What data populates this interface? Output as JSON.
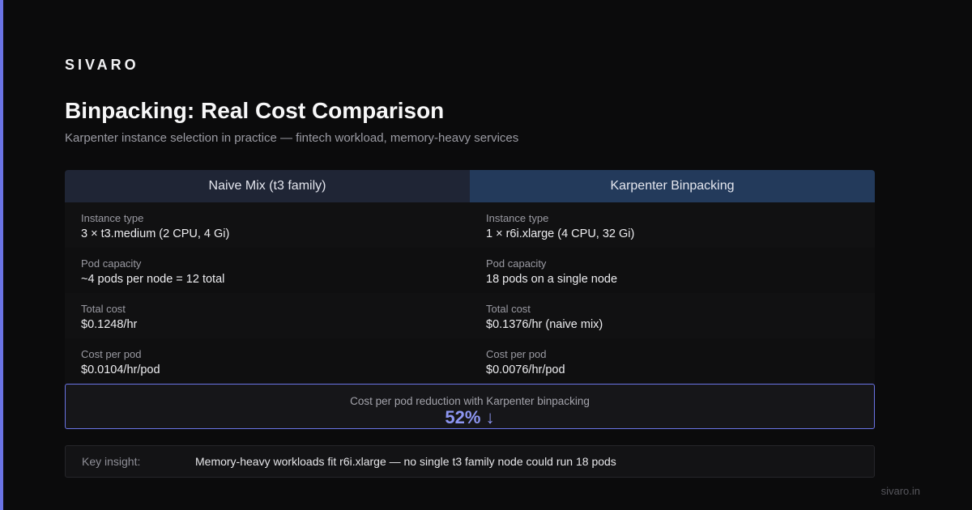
{
  "brand": {
    "logo": "SIVARO",
    "footer": "sivaro.in",
    "accent_color": "#6b74e6"
  },
  "header": {
    "title": "Binpacking: Real Cost Comparison",
    "subtitle": "Karpenter instance selection in practice — fintech workload, memory-heavy services"
  },
  "comparison": {
    "left": {
      "title": "Naive Mix (t3 family)",
      "rows": [
        {
          "label": "Instance type",
          "value": "3 × t3.medium (2 CPU, 4 Gi)"
        },
        {
          "label": "Pod capacity",
          "value": "~4 pods per node = 12 total"
        },
        {
          "label": "Total cost",
          "value": "$0.1248/hr"
        },
        {
          "label": "Cost per pod",
          "value": "$0.0104/hr/pod"
        }
      ]
    },
    "right": {
      "title": "Karpenter Binpacking",
      "rows": [
        {
          "label": "Instance type",
          "value": "1 × r6i.xlarge (4 CPU, 32 Gi)"
        },
        {
          "label": "Pod capacity",
          "value": "18 pods on a single node"
        },
        {
          "label": "Total cost",
          "value": "$0.1376/hr (naive mix)"
        },
        {
          "label": "Cost per pod",
          "value": "$0.0076/hr/pod"
        }
      ]
    }
  },
  "highlight": {
    "label": "Cost per pod reduction with Karpenter binpacking",
    "value": "52% ↓"
  },
  "insight": {
    "label": "Key insight:",
    "text": "Memory-heavy workloads fit r6i.xlarge — no single t3 family node could run 18 pods"
  }
}
